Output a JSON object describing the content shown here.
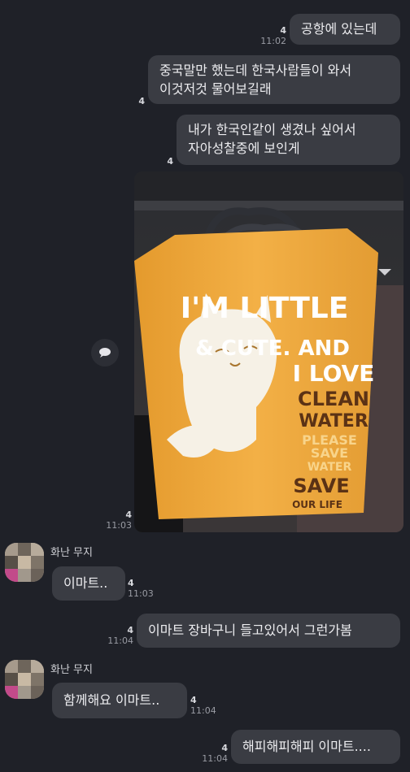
{
  "messages": [
    {
      "text": "공항에 있는데",
      "count": "4",
      "time": "11:02"
    },
    {
      "lines": [
        "중국말만 했는데 한국사람들이 와서",
        "이것저것 물어보길래"
      ],
      "count": "4"
    },
    {
      "lines": [
        "내가 한국인같이 생겼나 싶어서",
        "자아성찰중에 보인게"
      ],
      "count": "4"
    },
    {
      "photo_text": [
        "I'M LITTLE",
        "& CUTE. AND",
        "I LOVE",
        "CLEAN",
        "WATER",
        "PLEASE",
        "SAVE",
        "WATER",
        "SAVE",
        "OUR LIFE"
      ],
      "count": "4",
      "time": "11:03"
    },
    {
      "sender": "화난 무지",
      "text": "이마트..",
      "count": "4",
      "time": "11:03"
    },
    {
      "text": "이마트 장바구니 들고있어서 그런가봄",
      "count": "4",
      "time": "11:04"
    },
    {
      "sender": "화난 무지",
      "text": "함께해요 이마트..",
      "count": "4",
      "time": "11:04"
    },
    {
      "text": "해피해피해피 이마트....",
      "count": "4",
      "time": "11:04"
    }
  ],
  "icons": {
    "side": "comment-bubble-icon"
  },
  "colors": {
    "background": "#1f2128",
    "bubble": "#3a3c43",
    "bag": "#f0a93a"
  }
}
